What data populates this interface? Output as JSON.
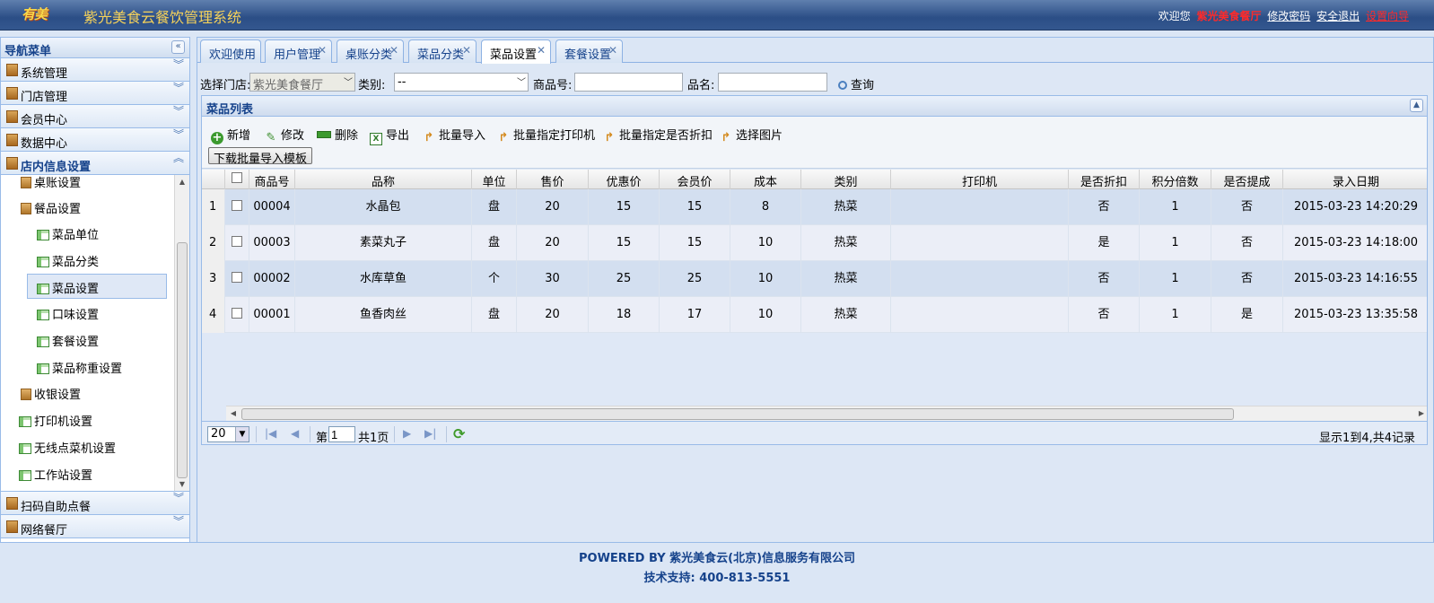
{
  "header": {
    "logo_text": "有美",
    "title": "紫光美食云餐饮管理系统",
    "welcome": "欢迎您",
    "store_name": "紫光美食餐厅",
    "change_password": "修改密码",
    "logout": "安全退出",
    "wizard": "设置向导"
  },
  "sidebar": {
    "title": "导航菜单",
    "top_items": [
      {
        "label": "系统管理"
      },
      {
        "label": "门店管理"
      },
      {
        "label": "会员中心"
      },
      {
        "label": "数据中心"
      },
      {
        "label": "店内信息设置"
      }
    ],
    "tree": [
      {
        "label": "桌账设置"
      },
      {
        "label": "餐品设置"
      },
      {
        "label": "菜品单位"
      },
      {
        "label": "菜品分类"
      },
      {
        "label": "菜品设置"
      },
      {
        "label": "口味设置"
      },
      {
        "label": "套餐设置"
      },
      {
        "label": "菜品称重设置"
      },
      {
        "label": "收银设置"
      },
      {
        "label": "打印机设置"
      },
      {
        "label": "无线点菜机设置"
      },
      {
        "label": "工作站设置"
      }
    ],
    "bottom_items": [
      {
        "label": "扫码自助点餐"
      },
      {
        "label": "网络餐厅"
      }
    ]
  },
  "tabs": [
    {
      "label": "欢迎使用"
    },
    {
      "label": "用户管理"
    },
    {
      "label": "桌账分类"
    },
    {
      "label": "菜品分类"
    },
    {
      "label": "菜品设置"
    },
    {
      "label": "套餐设置"
    }
  ],
  "filter": {
    "store_label": "选择门店:",
    "store_value": "紫光美食餐厅",
    "category_label": "类别:",
    "category_value": "--",
    "code_label": "商品号:",
    "code_value": "",
    "name_label": "品名:",
    "name_value": "",
    "query_label": "查询"
  },
  "panel": {
    "title": "菜品列表",
    "toolbar": [
      {
        "label": "新增",
        "icon": "add-icon"
      },
      {
        "label": "修改",
        "icon": "edit-icon"
      },
      {
        "label": "删除",
        "icon": "delete-icon"
      },
      {
        "label": "导出",
        "icon": "excel-icon"
      },
      {
        "label": "批量导入",
        "icon": "import-icon"
      },
      {
        "label": "批量指定打印机",
        "icon": "import-icon"
      },
      {
        "label": "批量指定是否折扣",
        "icon": "import-icon"
      },
      {
        "label": "选择图片",
        "icon": "import-icon"
      }
    ],
    "template_button": "下载批量导入模板"
  },
  "table": {
    "columns": [
      "商品号",
      "品称",
      "单位",
      "售价",
      "优惠价",
      "会员价",
      "成本",
      "类别",
      "打印机",
      "是否折扣",
      "积分倍数",
      "是否提成",
      "录入日期"
    ],
    "rows": [
      {
        "num": "1",
        "code": "00004",
        "name": "水晶包",
        "unit": "盘",
        "price": "20",
        "discount_price": "15",
        "member_price": "15",
        "cost": "8",
        "category": "热菜",
        "printer": "",
        "discount": "否",
        "points": "1",
        "commission": "否",
        "date": "2015-03-23 14:20:29"
      },
      {
        "num": "2",
        "code": "00003",
        "name": "素菜丸子",
        "unit": "盘",
        "price": "20",
        "discount_price": "15",
        "member_price": "15",
        "cost": "10",
        "category": "热菜",
        "printer": "",
        "discount": "是",
        "points": "1",
        "commission": "否",
        "date": "2015-03-23 14:18:00"
      },
      {
        "num": "3",
        "code": "00002",
        "name": "水库草鱼",
        "unit": "个",
        "price": "30",
        "discount_price": "25",
        "member_price": "25",
        "cost": "10",
        "category": "热菜",
        "printer": "",
        "discount": "否",
        "points": "1",
        "commission": "否",
        "date": "2015-03-23 14:16:55"
      },
      {
        "num": "4",
        "code": "00001",
        "name": "鱼香肉丝",
        "unit": "盘",
        "price": "20",
        "discount_price": "18",
        "member_price": "17",
        "cost": "10",
        "category": "热菜",
        "printer": "",
        "discount": "否",
        "points": "1",
        "commission": "是",
        "date": "2015-03-23 13:35:58"
      }
    ]
  },
  "pager": {
    "page_size": "20",
    "page_prefix": "第",
    "page_value": "1",
    "page_suffix": "共1页",
    "info": "显示1到4,共4记录"
  },
  "footer": {
    "line1": "POWERED BY 紫光美食云(北京)信息服务有限公司",
    "line2": "技术支持: 400-813-5551"
  }
}
